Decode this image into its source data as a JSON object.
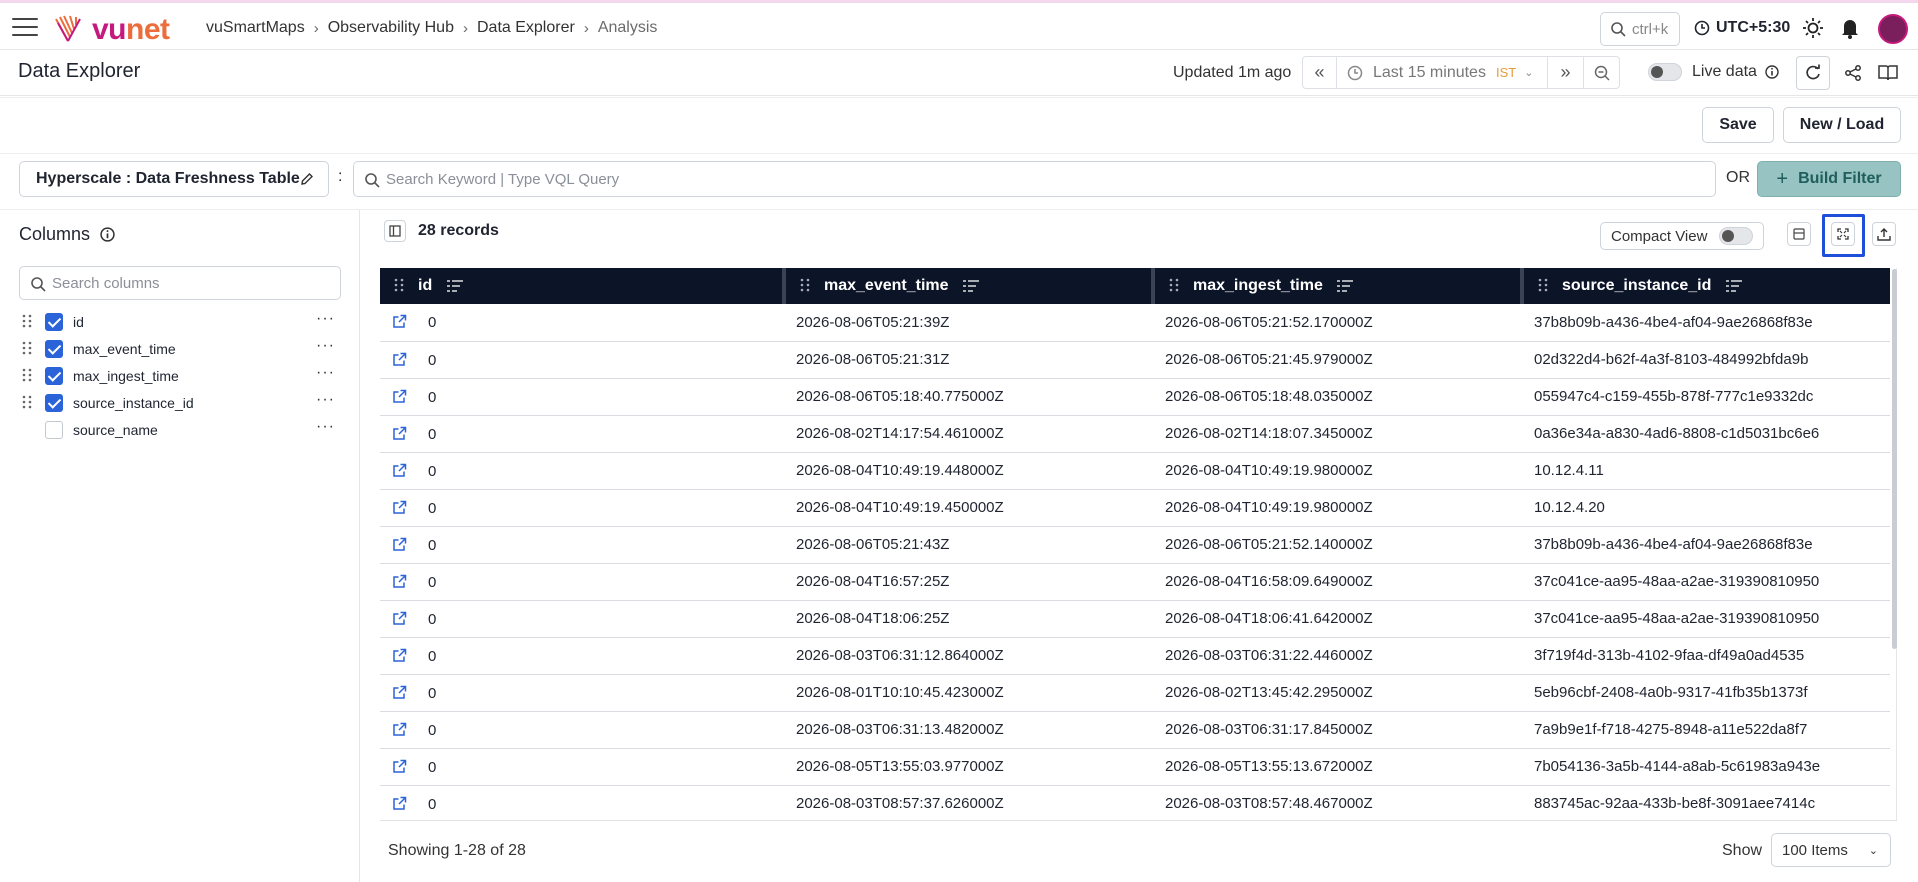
{
  "header": {
    "breadcrumb": [
      "vuSmartMaps",
      "Observability Hub",
      "Data Explorer",
      "Analysis"
    ],
    "search_hint": "ctrl+k",
    "timezone": "UTC+5:30",
    "logo": {
      "part1": "vu",
      "part2": "net",
      "color1": "#c6197d",
      "color2": "#ec6c3c"
    }
  },
  "subheader": {
    "title": "Data Explorer",
    "updated": "Updated 1m ago",
    "time_range": "Last 15 minutes",
    "time_zone_tag": "IST",
    "live_label": "Live data"
  },
  "actions": {
    "save": "Save",
    "new_load": "New / Load"
  },
  "query": {
    "source": "Hyperscale : Data Freshness Table",
    "separator": ":",
    "placeholder": "Search Keyword | Type VQL Query",
    "or_label": "OR",
    "build_filter": "Build Filter"
  },
  "columns_panel": {
    "title": "Columns",
    "search_placeholder": "Search columns",
    "items": [
      {
        "label": "id",
        "checked": true
      },
      {
        "label": "max_event_time",
        "checked": true
      },
      {
        "label": "max_ingest_time",
        "checked": true
      },
      {
        "label": "source_instance_id",
        "checked": true
      },
      {
        "label": "source_name",
        "checked": false
      }
    ]
  },
  "table": {
    "records": "28 records",
    "compact_view": "Compact View",
    "headers": [
      "id",
      "max_event_time",
      "max_ingest_time",
      "source_instance_id"
    ],
    "rows": [
      [
        "0",
        "2026-08-06T05:21:39Z",
        "2026-08-06T05:21:52.170000Z",
        "37b8b09b-a436-4be4-af04-9ae26868f83e"
      ],
      [
        "0",
        "2026-08-06T05:21:31Z",
        "2026-08-06T05:21:45.979000Z",
        "02d322d4-b62f-4a3f-8103-484992bfda9b"
      ],
      [
        "0",
        "2026-08-06T05:18:40.775000Z",
        "2026-08-06T05:18:48.035000Z",
        "055947c4-c159-455b-878f-777c1e9332dc"
      ],
      [
        "0",
        "2026-08-02T14:17:54.461000Z",
        "2026-08-02T14:18:07.345000Z",
        "0a36e34a-a830-4ad6-8808-c1d5031bc6e6"
      ],
      [
        "0",
        "2026-08-04T10:49:19.448000Z",
        "2026-08-04T10:49:19.980000Z",
        "10.12.4.11"
      ],
      [
        "0",
        "2026-08-04T10:49:19.450000Z",
        "2026-08-04T10:49:19.980000Z",
        "10.12.4.20"
      ],
      [
        "0",
        "2026-08-06T05:21:43Z",
        "2026-08-06T05:21:52.140000Z",
        "37b8b09b-a436-4be4-af04-9ae26868f83e"
      ],
      [
        "0",
        "2026-08-04T16:57:25Z",
        "2026-08-04T16:58:09.649000Z",
        "37c041ce-aa95-48aa-a2ae-319390810950"
      ],
      [
        "0",
        "2026-08-04T18:06:25Z",
        "2026-08-04T18:06:41.642000Z",
        "37c041ce-aa95-48aa-a2ae-319390810950"
      ],
      [
        "0",
        "2026-08-03T06:31:12.864000Z",
        "2026-08-03T06:31:22.446000Z",
        "3f719f4d-313b-4102-9faa-df49a0ad4535"
      ],
      [
        "0",
        "2026-08-01T10:10:45.423000Z",
        "2026-08-02T13:45:42.295000Z",
        "5eb96cbf-2408-4a0b-9317-41fb35b1373f"
      ],
      [
        "0",
        "2026-08-03T06:31:13.482000Z",
        "2026-08-03T06:31:17.845000Z",
        "7a9b9e1f-f718-4275-8948-a11e522da8f7"
      ],
      [
        "0",
        "2026-08-05T13:55:03.977000Z",
        "2026-08-05T13:55:13.672000Z",
        "7b054136-3a5b-4144-a8ab-5c61983a943e"
      ],
      [
        "0",
        "2026-08-03T08:57:37.626000Z",
        "2026-08-03T08:57:48.467000Z",
        "883745ac-92aa-433b-be8f-3091aee7414c"
      ]
    ]
  },
  "footer": {
    "showing": "Showing 1-28 of 28",
    "show_label": "Show",
    "page_size": "100 Items"
  }
}
